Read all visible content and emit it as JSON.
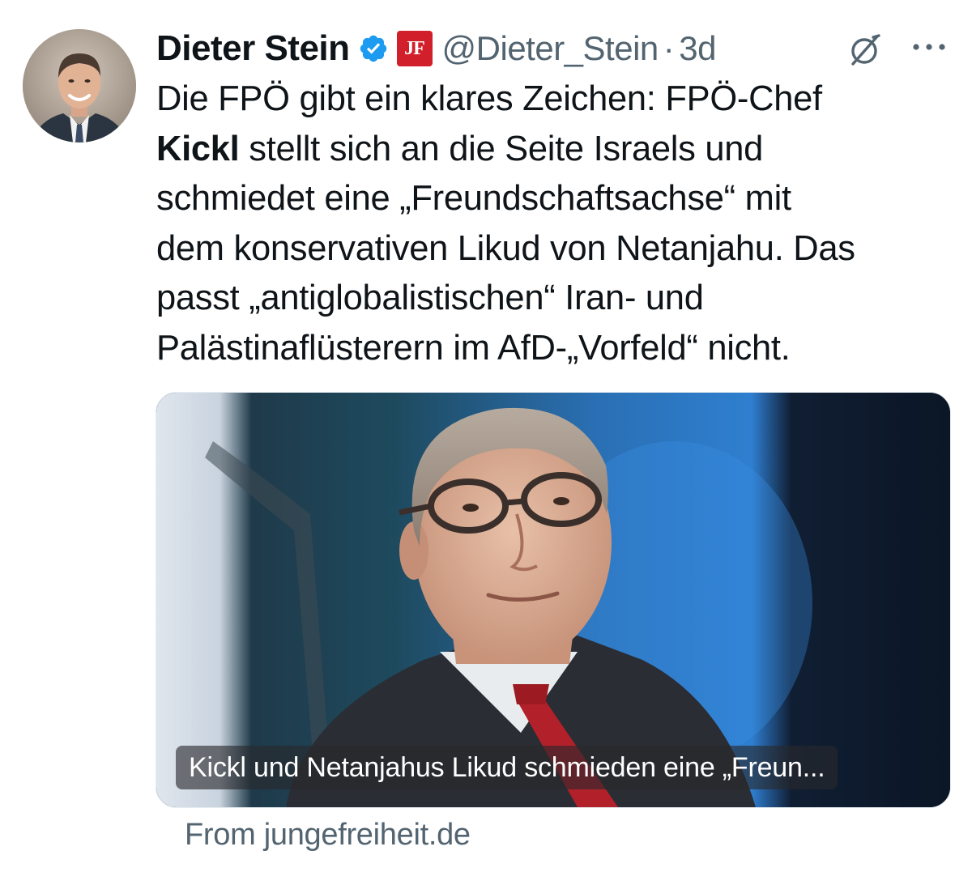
{
  "author": {
    "display_name": "Dieter Stein",
    "handle": "@Dieter_Stein",
    "separator": "·",
    "time": "3d",
    "affiliation_badge": "JF"
  },
  "tweet": {
    "lines": [
      {
        "pre": "Die FPÖ gibt ein klares Zeichen: FPÖ-Chef",
        "bold": "",
        "post": ""
      },
      {
        "pre": "",
        "bold": "Kickl",
        "post": " stellt sich an die Seite Israels und"
      },
      {
        "pre": "schmiedet eine „Freundschaftsachse“ mit",
        "bold": "",
        "post": ""
      },
      {
        "pre": "dem konservativen Likud von Netanjahu. Das",
        "bold": "",
        "post": ""
      },
      {
        "pre": "passt „antiglobalistischen“ Iran- und",
        "bold": "",
        "post": ""
      },
      {
        "pre": "Palästinaflüsterern im AfD-„Vorfeld“ nicht.",
        "bold": "",
        "post": ""
      }
    ]
  },
  "card": {
    "caption": "Kickl und Netanjahus Likud schmieden eine „Freun...",
    "source": "From jungefreiheit.de"
  },
  "icons": {
    "verified": "verified-badge-icon",
    "grok": "grok-icon",
    "more": "more-options-icon"
  },
  "colors": {
    "text_primary": "#0f1419",
    "text_secondary": "#536471",
    "verified_blue": "#1d9bf0",
    "badge_red": "#d11f2b"
  }
}
